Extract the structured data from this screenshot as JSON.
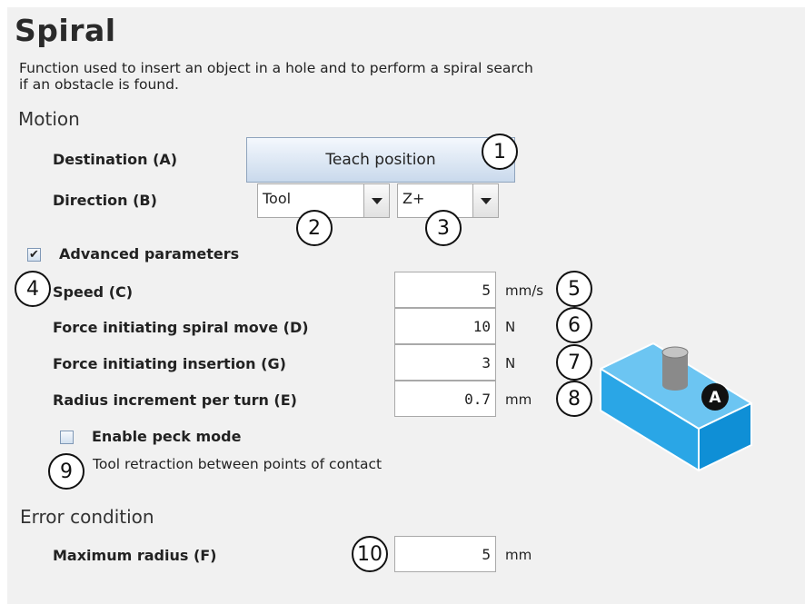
{
  "header": {
    "title": "Spiral",
    "description_line1": "Function used to insert an object in a hole and to perform a spiral search",
    "description_line2": "if an obstacle is found."
  },
  "motion": {
    "section_label": "Motion",
    "destination_label": "Destination (A)",
    "teach_button_label": "Teach position",
    "direction_label": "Direction (B)",
    "frame_select": "Tool",
    "axis_select": "Z+"
  },
  "advanced": {
    "checked": true,
    "check_mark": "✔",
    "label": "Advanced parameters",
    "speed": {
      "label": "Speed (C)",
      "value": "5",
      "unit": "mm/s"
    },
    "force_spiral": {
      "label": "Force initiating spiral move (D)",
      "value": "10",
      "unit": "N"
    },
    "force_insert": {
      "label": "Force initiating insertion (G)",
      "value": "3",
      "unit": "N"
    },
    "radius_increment": {
      "label": "Radius increment per turn (E)",
      "value": "0.7",
      "unit": "mm"
    },
    "peck_mode": {
      "checked": false,
      "label": "Enable peck mode",
      "hint": "Tool retraction between points of contact"
    }
  },
  "error": {
    "section_label": "Error condition",
    "max_radius": {
      "label": "Maximum radius (F)",
      "value": "5",
      "unit": "mm"
    }
  },
  "callouts": [
    "1",
    "2",
    "3",
    "4",
    "5",
    "6",
    "7",
    "8",
    "9",
    "10"
  ],
  "illustration": {
    "marker": "A"
  },
  "colors": {
    "panel_bg": "#f1f1f1",
    "button_gradient_top": "#f4f8fd",
    "button_gradient_bottom": "#c9d9ec",
    "block_top": "#6cc5f2",
    "block_front": "#2aa6e6",
    "block_side": "#0f8fd6"
  }
}
